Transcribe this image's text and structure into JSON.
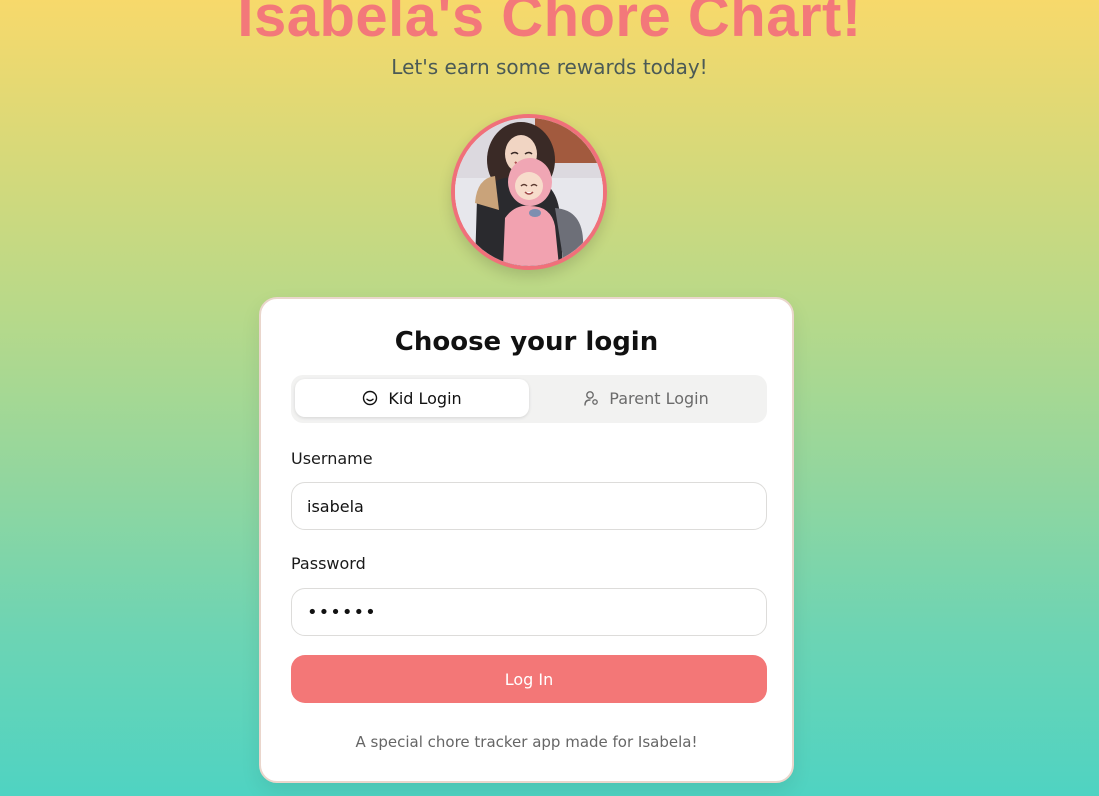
{
  "header": {
    "title": "Isabela's Chore Chart!",
    "subtitle": "Let's earn some rewards today!"
  },
  "card": {
    "title": "Choose your login",
    "tabs": [
      {
        "label": "Kid Login",
        "icon": "smile-icon",
        "active": true
      },
      {
        "label": "Parent Login",
        "icon": "user-shield-icon",
        "active": false
      }
    ],
    "username": {
      "label": "Username",
      "value": "isabela"
    },
    "password": {
      "label": "Password",
      "masked_value": "••••••"
    },
    "login_button": "Log In",
    "footer": "A special chore tracker app made for Isabela!"
  },
  "colors": {
    "title": "#f3787a",
    "button": "#f37777",
    "avatar_border": "#f0707a"
  }
}
